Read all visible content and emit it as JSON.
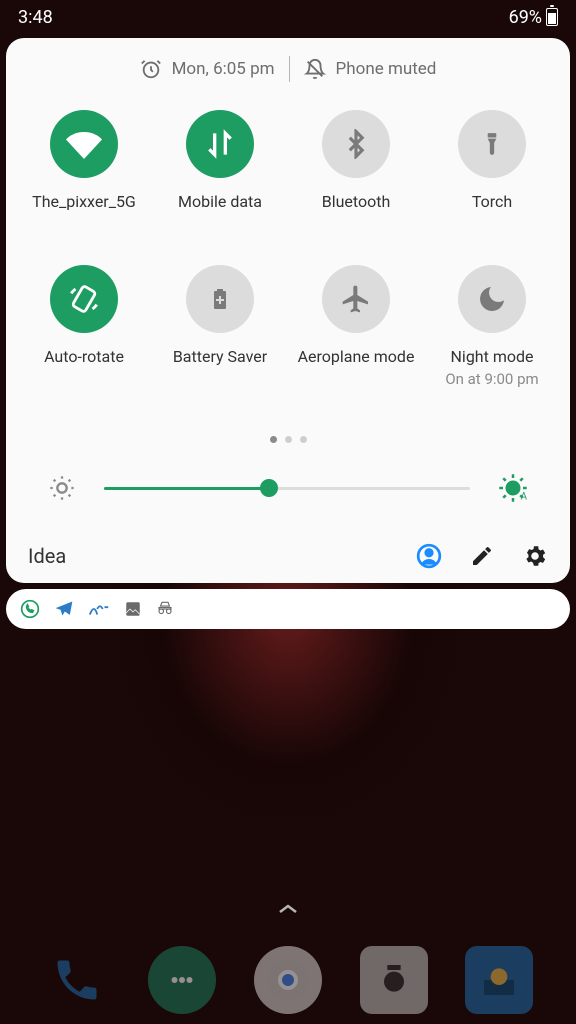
{
  "status": {
    "time": "3:48",
    "battery_pct": "69%"
  },
  "qs": {
    "alarm_text": "Mon, 6:05 pm",
    "mute_text": "Phone muted",
    "tiles": [
      {
        "label": "The_pixxer_5G",
        "on": true
      },
      {
        "label": "Mobile data",
        "on": true
      },
      {
        "label": "Bluetooth",
        "on": false
      },
      {
        "label": "Torch",
        "on": false
      },
      {
        "label": "Auto-rotate",
        "on": true
      },
      {
        "label": "Battery Saver",
        "on": false
      },
      {
        "label": "Aeroplane mode",
        "on": false
      },
      {
        "label": "Night mode",
        "on": false,
        "sub": "On at 9:00 pm"
      }
    ],
    "pages": {
      "count": 3,
      "active": 0
    },
    "brightness_pct": 45,
    "carrier": "Idea"
  },
  "dock": {
    "apps": [
      "phone",
      "messages",
      "chrome",
      "camera",
      "gallery"
    ]
  }
}
